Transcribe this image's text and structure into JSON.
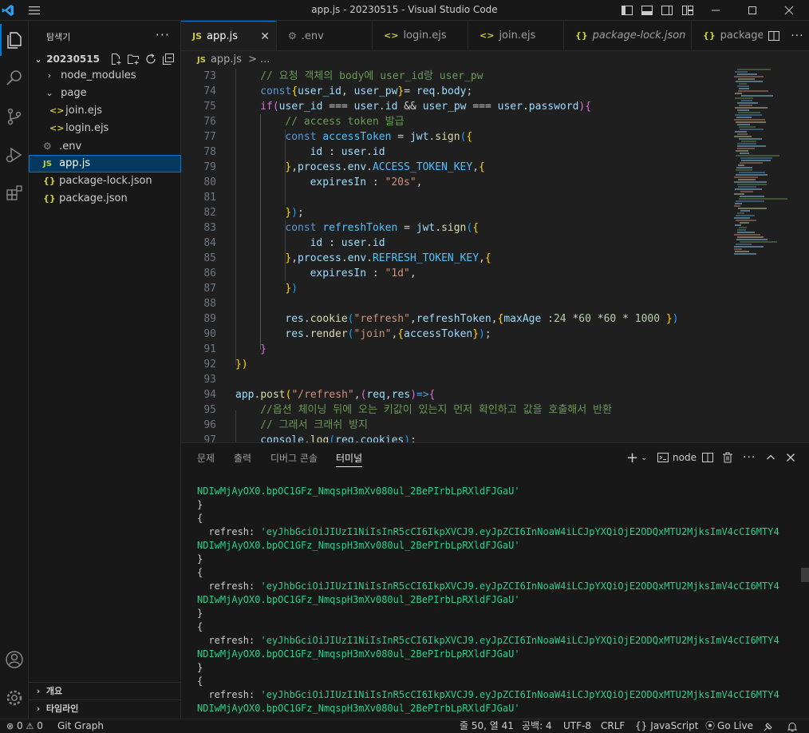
{
  "window": {
    "title": "app.js - 20230515 - Visual Studio Code"
  },
  "sidebar": {
    "header": "탐색기",
    "workspace": "20230515",
    "items": [
      {
        "label": "node_modules",
        "type": "folder"
      },
      {
        "label": "page",
        "type": "folder"
      },
      {
        "label": "join.ejs",
        "type": "ejs"
      },
      {
        "label": "login.ejs",
        "type": "ejs"
      },
      {
        "label": ".env",
        "type": "env"
      },
      {
        "label": "app.js",
        "type": "js",
        "selected": true
      },
      {
        "label": "package-lock.json",
        "type": "json"
      },
      {
        "label": "package.json",
        "type": "json"
      }
    ],
    "outline_label": "개요",
    "timeline_label": "타임라인"
  },
  "tabs": [
    {
      "label": "app.js",
      "icon": "JS",
      "active": true
    },
    {
      "label": ".env",
      "icon": "⚙"
    },
    {
      "label": "login.ejs",
      "icon": "<>"
    },
    {
      "label": "join.ejs",
      "icon": "<>"
    },
    {
      "label": "package-lock.json",
      "icon": "{}"
    },
    {
      "label": "package.",
      "icon": "{}"
    }
  ],
  "breadcrumb": {
    "icon": "JS",
    "file": "app.js",
    "sep": ">",
    "rest": "..."
  },
  "editor": {
    "line_numbers": [
      "73",
      "74",
      "75",
      "76",
      "77",
      "78",
      "79",
      "80",
      "81",
      "82",
      "83",
      "84",
      "85",
      "86",
      "87",
      "88",
      "89",
      "90",
      "91",
      "92",
      "93",
      "94",
      "95",
      "96",
      "97"
    ],
    "lines": [
      [
        [
          "c",
          "// 요청 객체의 body에 user_id랑 user_pw"
        ]
      ],
      [
        [
          "k",
          "const"
        ],
        [
          "y",
          "{"
        ],
        [
          "v",
          "user_id"
        ],
        [
          "p",
          ", "
        ],
        [
          "v",
          "user_pw"
        ],
        [
          "y",
          "}"
        ],
        [
          "p",
          "= "
        ],
        [
          "v",
          "req"
        ],
        [
          "p",
          "."
        ],
        [
          "v",
          "body"
        ],
        [
          "p",
          ";"
        ]
      ],
      [
        [
          "m",
          "if"
        ],
        [
          "m",
          "("
        ],
        [
          "v",
          "user_id"
        ],
        [
          "p",
          " === "
        ],
        [
          "v",
          "user"
        ],
        [
          "p",
          "."
        ],
        [
          "v",
          "id"
        ],
        [
          "p",
          " && "
        ],
        [
          "v",
          "user_pw"
        ],
        [
          "p",
          " === "
        ],
        [
          "v",
          "user"
        ],
        [
          "p",
          "."
        ],
        [
          "v",
          "password"
        ],
        [
          "m",
          ")"
        ],
        [
          "m",
          "{"
        ]
      ],
      [
        [
          "c",
          "// access token 발급"
        ]
      ],
      [
        [
          "k",
          "const"
        ],
        [
          "p",
          " "
        ],
        [
          "cst",
          "accessToken"
        ],
        [
          "p",
          " = "
        ],
        [
          "v",
          "jwt"
        ],
        [
          "p",
          "."
        ],
        [
          "f",
          "sign"
        ],
        [
          "b",
          "("
        ],
        [
          "y",
          "{"
        ]
      ],
      [
        [
          "v",
          "id"
        ],
        [
          "p",
          " : "
        ],
        [
          "v",
          "user"
        ],
        [
          "p",
          "."
        ],
        [
          "v",
          "id"
        ]
      ],
      [
        [
          "y",
          "}"
        ],
        [
          "p",
          ","
        ],
        [
          "v",
          "process"
        ],
        [
          "p",
          "."
        ],
        [
          "v",
          "env"
        ],
        [
          "p",
          "."
        ],
        [
          "cst",
          "ACCESS_TOKEN_KEY"
        ],
        [
          "p",
          ","
        ],
        [
          "y",
          "{"
        ]
      ],
      [
        [
          "v",
          "expiresIn"
        ],
        [
          "p",
          " : "
        ],
        [
          "s",
          "\"20s\""
        ],
        [
          "p",
          ","
        ]
      ],
      [
        [
          "p",
          ""
        ]
      ],
      [
        [
          "y",
          "}"
        ],
        [
          "b",
          ")"
        ],
        [
          "p",
          ";"
        ]
      ],
      [
        [
          "k",
          "const"
        ],
        [
          "p",
          " "
        ],
        [
          "cst",
          "refreshToken"
        ],
        [
          "p",
          " = "
        ],
        [
          "v",
          "jwt"
        ],
        [
          "p",
          "."
        ],
        [
          "f",
          "sign"
        ],
        [
          "b",
          "("
        ],
        [
          "y",
          "{"
        ]
      ],
      [
        [
          "v",
          "id"
        ],
        [
          "p",
          " : "
        ],
        [
          "v",
          "user"
        ],
        [
          "p",
          "."
        ],
        [
          "v",
          "id"
        ]
      ],
      [
        [
          "y",
          "}"
        ],
        [
          "p",
          ","
        ],
        [
          "v",
          "process"
        ],
        [
          "p",
          "."
        ],
        [
          "v",
          "env"
        ],
        [
          "p",
          "."
        ],
        [
          "cst",
          "REFRESH_TOKEN_KEY"
        ],
        [
          "p",
          ","
        ],
        [
          "y",
          "{"
        ]
      ],
      [
        [
          "v",
          "expiresIn"
        ],
        [
          "p",
          " : "
        ],
        [
          "s",
          "\"1d\""
        ],
        [
          "p",
          ","
        ]
      ],
      [
        [
          "y",
          "}"
        ],
        [
          "b",
          ")"
        ]
      ],
      [
        [
          "p",
          ""
        ]
      ],
      [
        [
          "v",
          "res"
        ],
        [
          "p",
          "."
        ],
        [
          "f",
          "cookie"
        ],
        [
          "b",
          "("
        ],
        [
          "s",
          "\"refresh\""
        ],
        [
          "p",
          ","
        ],
        [
          "v",
          "refreshToken"
        ],
        [
          "p",
          ","
        ],
        [
          "y",
          "{"
        ],
        [
          "v",
          "maxAge"
        ],
        [
          "p",
          " :"
        ],
        [
          "n",
          "24"
        ],
        [
          "p",
          " *"
        ],
        [
          "n",
          "60"
        ],
        [
          "p",
          " *"
        ],
        [
          "n",
          "60"
        ],
        [
          "p",
          " * "
        ],
        [
          "n",
          "1000"
        ],
        [
          "p",
          " "
        ],
        [
          "y",
          "}"
        ],
        [
          "b",
          ")"
        ]
      ],
      [
        [
          "v",
          "res"
        ],
        [
          "p",
          "."
        ],
        [
          "f",
          "render"
        ],
        [
          "b",
          "("
        ],
        [
          "s",
          "\"join\""
        ],
        [
          "p",
          ","
        ],
        [
          "y",
          "{"
        ],
        [
          "v",
          "accessToken"
        ],
        [
          "y",
          "}"
        ],
        [
          "b",
          ")"
        ],
        [
          "p",
          ";"
        ]
      ],
      [
        [
          "m",
          "}"
        ]
      ],
      [
        [
          "y",
          "})"
        ]
      ],
      [
        [
          "p",
          ""
        ]
      ],
      [
        [
          "v",
          "app"
        ],
        [
          "p",
          "."
        ],
        [
          "f",
          "post"
        ],
        [
          "y",
          "("
        ],
        [
          "s",
          "\"/refresh\""
        ],
        [
          "p",
          ","
        ],
        [
          "m",
          "("
        ],
        [
          "v",
          "req"
        ],
        [
          "p",
          ","
        ],
        [
          "v",
          "res"
        ],
        [
          "m",
          ")"
        ],
        [
          "k",
          "=>"
        ],
        [
          "m",
          "{"
        ]
      ],
      [
        [
          "c",
          "//옵션 체이닝 뒤에 오는 키값이 있는지 먼저 확인하고 값을 호출해서 반환"
        ]
      ],
      [
        [
          "c",
          "// 그래서 크래쉬 방지"
        ]
      ],
      [
        [
          "v",
          "console"
        ],
        [
          "p",
          "."
        ],
        [
          "f",
          "log"
        ],
        [
          "b",
          "("
        ],
        [
          "v",
          "req"
        ],
        [
          "p",
          "."
        ],
        [
          "v",
          "cookies"
        ],
        [
          "b",
          ")"
        ],
        [
          "p",
          ";"
        ]
      ]
    ]
  },
  "panel": {
    "tabs": [
      "문제",
      "출력",
      "디버그 콘솔",
      "터미널"
    ],
    "active_tab": "터미널",
    "terminal_name": "node",
    "terminal_lines": [
      [
        "",
        "NDIwMjAyOX0.bpOC1GFz_NmqspH3mXv080ul_2BePIrbLpRXldFJGaU'"
      ],
      [
        "}",
        ""
      ],
      [
        "{",
        ""
      ],
      [
        "  refresh: ",
        "'eyJhbGciOiJIUzI1NiIsInR5cCI6IkpXVCJ9.eyJpZCI6InNoaW4iLCJpYXQiOjE2ODQxMTU2MjksImV4cCI6MTY4"
      ],
      [
        "",
        "NDIwMjAyOX0.bpOC1GFz_NmqspH3mXv080ul_2BePIrbLpRXldFJGaU'"
      ],
      [
        "}",
        ""
      ],
      [
        "{",
        ""
      ],
      [
        "  refresh: ",
        "'eyJhbGciOiJIUzI1NiIsInR5cCI6IkpXVCJ9.eyJpZCI6InNoaW4iLCJpYXQiOjE2ODQxMTU2MjksImV4cCI6MTY4"
      ],
      [
        "",
        "NDIwMjAyOX0.bpOC1GFz_NmqspH3mXv080ul_2BePIrbLpRXldFJGaU'"
      ],
      [
        "}",
        ""
      ],
      [
        "{",
        ""
      ],
      [
        "  refresh: ",
        "'eyJhbGciOiJIUzI1NiIsInR5cCI6IkpXVCJ9.eyJpZCI6InNoaW4iLCJpYXQiOjE2ODQxMTU2MjksImV4cCI6MTY4"
      ],
      [
        "",
        "NDIwMjAyOX0.bpOC1GFz_NmqspH3mXv080ul_2BePIrbLpRXldFJGaU'"
      ],
      [
        "}",
        ""
      ],
      [
        "{",
        ""
      ],
      [
        "  refresh: ",
        "'eyJhbGciOiJIUzI1NiIsInR5cCI6IkpXVCJ9.eyJpZCI6InNoaW4iLCJpYXQiOjE2ODQxMTU2MjksImV4cCI6MTY4"
      ],
      [
        "",
        "NDIwMjAyOX0.bpOC1GFz_NmqspH3mXv080ul_2BePIrbLpRXldFJGaU'"
      ]
    ]
  },
  "status": {
    "errors": "0",
    "warnings": "0",
    "git": "Git Graph",
    "position": "줄 50, 열 41",
    "spaces": "공백: 4",
    "encoding": "UTF-8",
    "eol": "CRLF",
    "language": "JavaScript",
    "golive": "Go Live"
  },
  "colors": {
    "accent": "#0078d4",
    "terminal_string": "#23d18b"
  }
}
